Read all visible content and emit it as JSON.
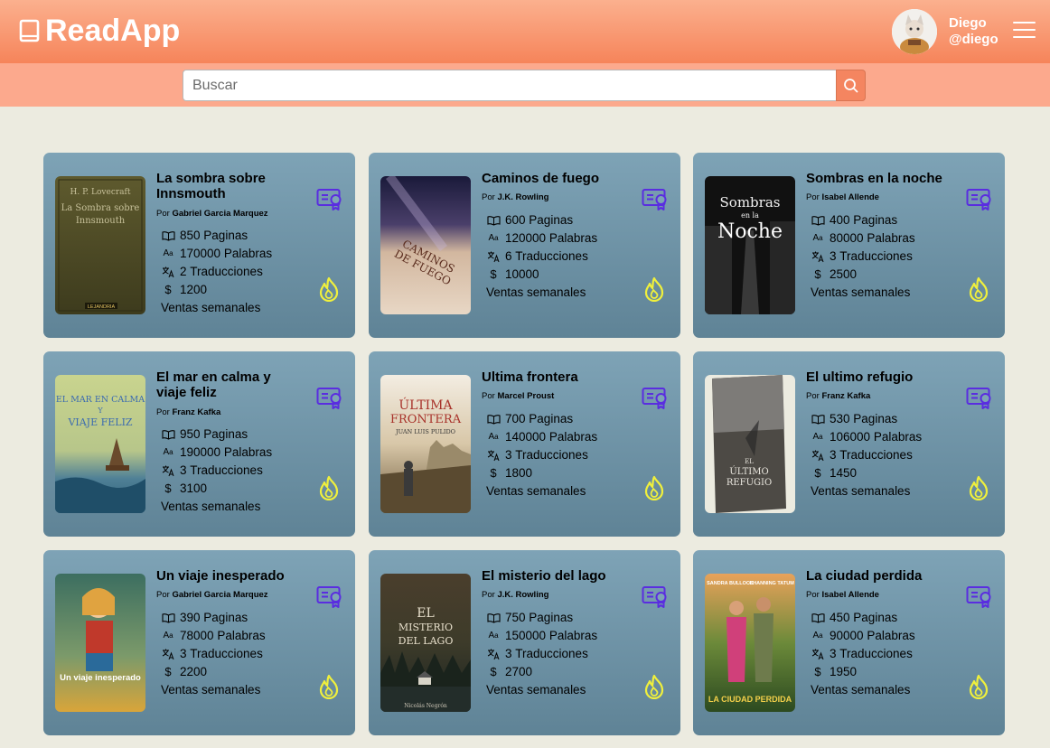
{
  "app": {
    "name": "ReadApp"
  },
  "user": {
    "name": "Diego",
    "handle": "@diego"
  },
  "search": {
    "placeholder": "Buscar",
    "value": ""
  },
  "colors": {
    "header": "#f6845a",
    "accent_icon": "#5a2de0",
    "fire": "#f0f03c"
  },
  "labels": {
    "by": "Por",
    "pages": "Paginas",
    "words": "Palabras",
    "translations": "Traducciones",
    "weekly_sales": "Ventas semanales"
  },
  "books": [
    {
      "title": "La sombra sobre Innsmouth",
      "author": "Gabriel Garcia Marquez",
      "pages": "850",
      "words": "170000",
      "translations": "2",
      "sales": "1200",
      "cover_text": [
        "H. P. Lovecraft",
        "La Sombra sobre",
        "Innsmouth"
      ],
      "cover_publisher": "LEJANDRIA"
    },
    {
      "title": "Caminos de fuego",
      "author": "J.K. Rowling",
      "pages": "600",
      "words": "120000",
      "translations": "6",
      "sales": "10000",
      "cover_text": [
        "CAMINOS",
        "DE FUEGO"
      ]
    },
    {
      "title": "Sombras en la noche",
      "author": "Isabel Allende",
      "pages": "400",
      "words": "80000",
      "translations": "3",
      "sales": "2500",
      "cover_text": [
        "Sombras",
        "en la",
        "Noche"
      ]
    },
    {
      "title": "El mar en calma y viaje feliz",
      "author": "Franz Kafka",
      "pages": "950",
      "words": "190000",
      "translations": "3",
      "sales": "3100",
      "cover_text": [
        "EL MAR EN CALMA",
        "Y",
        "VIAJE FELIZ"
      ]
    },
    {
      "title": "Ultima frontera",
      "author": "Marcel Proust",
      "pages": "700",
      "words": "140000",
      "translations": "3",
      "sales": "1800",
      "cover_text": [
        "ÚLTIMA",
        "FRONTERA",
        "JUAN LUIS PULIDO"
      ]
    },
    {
      "title": "El ultimo refugio",
      "author": "Franz Kafka",
      "pages": "530",
      "words": "106000",
      "translations": "3",
      "sales": "1450",
      "cover_text": [
        "EL",
        "ÚLTIMO",
        "REFUGIO"
      ]
    },
    {
      "title": "Un viaje inesperado",
      "author": "Gabriel Garcia Marquez",
      "pages": "390",
      "words": "78000",
      "translations": "3",
      "sales": "2200",
      "cover_text": [
        "Un viaje inesperado"
      ]
    },
    {
      "title": "El misterio del lago",
      "author": "J.K. Rowling",
      "pages": "750",
      "words": "150000",
      "translations": "3",
      "sales": "2700",
      "cover_text": [
        "EL",
        "MISTERIO",
        "DEL LAGO",
        "Nicolás Negrón"
      ]
    },
    {
      "title": "La ciudad perdida",
      "author": "Isabel Allende",
      "pages": "450",
      "words": "90000",
      "translations": "3",
      "sales": "1950",
      "cover_text": [
        "SANDRA BULLOCK",
        "CHANNING TATUM",
        "LA CIUDAD PERDIDA"
      ]
    }
  ]
}
